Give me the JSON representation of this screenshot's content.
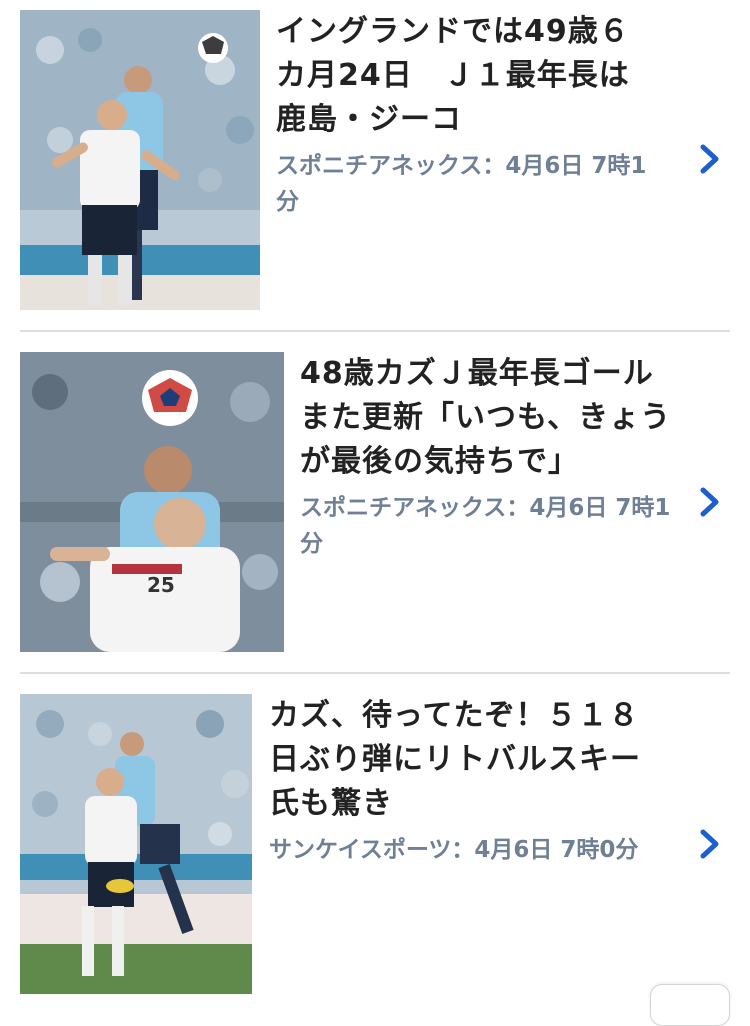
{
  "articles": [
    {
      "title": "イングランドでは49歳６カ月24日　Ｊ１最年長は鹿島・ジーコ",
      "source": "スポニチアネックス",
      "time": "4月6日 7時1分"
    },
    {
      "title": "48歳カズＪ最年長ゴールまた更新「いつも、きょうが最後の気持ちで」",
      "source": "スポニチアネックス",
      "time": "4月6日 7時1分"
    },
    {
      "title": "カズ、待ってたぞ！５１８日ぶり弾にリトバルスキー氏も驚き",
      "source": "サンケイスポーツ",
      "time": "4月6日 7時0分"
    }
  ],
  "meta_separator": "：",
  "icons": {
    "chevron": "chevron-right-icon"
  },
  "colors": {
    "title": "#222222",
    "meta": "#6f7f95",
    "chevron": "#1d5fcf",
    "divider": "#dedede",
    "jersey_sky": "#8ec6e6",
    "jersey_white": "#f4f4f4"
  }
}
